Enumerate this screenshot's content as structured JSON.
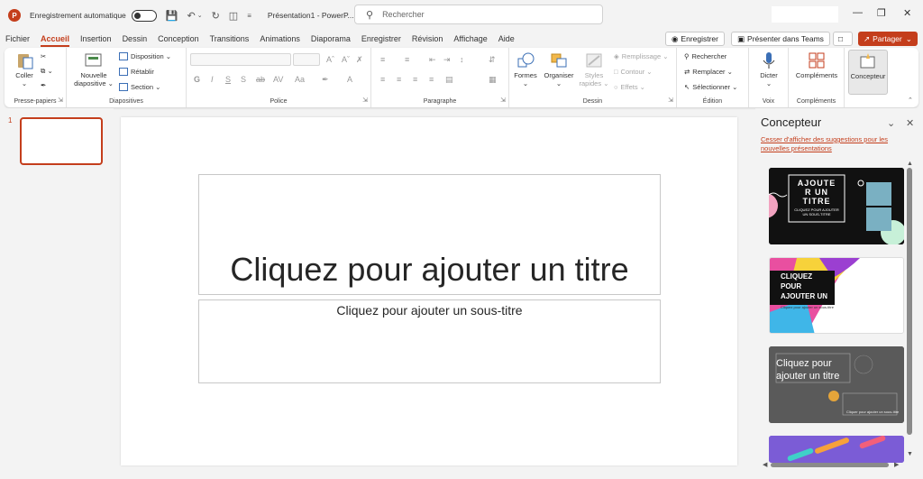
{
  "app": {
    "autosave_label": "Enregistrement automatique",
    "doc_title": "Présentation1 - PowerP...",
    "search_placeholder": "Rechercher"
  },
  "menu": [
    "Fichier",
    "Accueil",
    "Insertion",
    "Dessin",
    "Conception",
    "Transitions",
    "Animations",
    "Diaporama",
    "Enregistrer",
    "Révision",
    "Affichage",
    "Aide"
  ],
  "menu_active": "Accueil",
  "top_buttons": {
    "record": "Enregistrer",
    "teams": "Présenter dans Teams",
    "share": "Partager"
  },
  "ribbon": {
    "clipboard": {
      "label": "Presse-papiers",
      "paste": "Coller"
    },
    "slides": {
      "label": "Diapositives",
      "new_line1": "Nouvelle",
      "new_line2": "diapositive",
      "layout": "Disposition",
      "reset": "Rétablir",
      "section": "Section"
    },
    "font": {
      "label": "Police"
    },
    "paragraph": {
      "label": "Paragraphe"
    },
    "drawing": {
      "label": "Dessin",
      "shapes": "Formes",
      "arrange": "Organiser",
      "styles_line1": "Styles",
      "styles_line2": "rapides",
      "fill": "Remplissage",
      "outline": "Contour",
      "effects": "Effets"
    },
    "editing": {
      "label": "Édition",
      "find": "Rechercher",
      "replace": "Remplacer",
      "select": "Sélectionner"
    },
    "voice": {
      "label": "Voix",
      "dictate": "Dicter"
    },
    "addins": {
      "label": "Compléments",
      "addins": "Compléments"
    },
    "designer": {
      "designer": "Concepteur"
    }
  },
  "slide": {
    "number": "1",
    "title_placeholder": "Cliquez pour ajouter un titre",
    "subtitle_placeholder": "Cliquez pour ajouter un sous-titre"
  },
  "designer_pane": {
    "title": "Concepteur",
    "stop_link": "Cesser d'afficher des suggestions pour les nouvelles présentations",
    "card1_title": "AJOUTE R UN TITRE",
    "card1_sub": "CLIQUEZ POUR AJOUTER UN SOUS-TITRE",
    "card2_title": "CLIQUEZ POUR AJOUTER UN",
    "card2_sub": "Cliquez pour ajouter un sous-titre",
    "card3_title": "Cliquez pour ajouter un titre",
    "card3_sub": "Cliquer pour ajouter un sous-titre"
  },
  "colors": {
    "accent": "#c43e1c",
    "purple": "#7719aa"
  }
}
